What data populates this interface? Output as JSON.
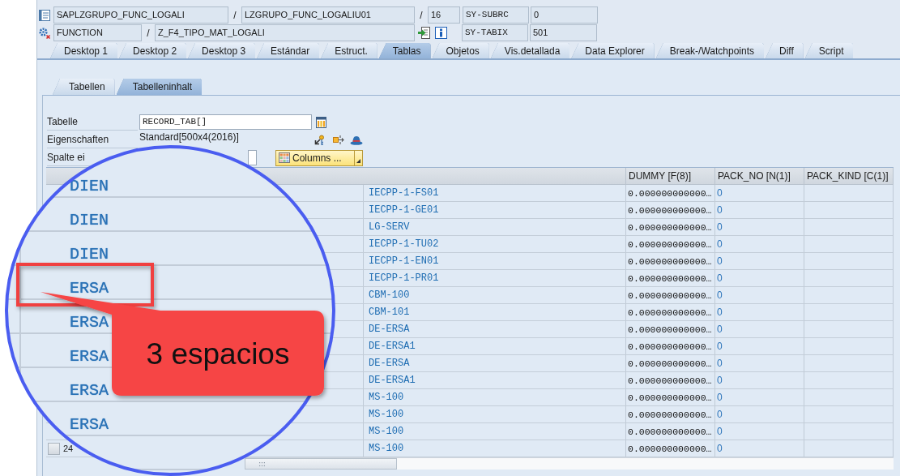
{
  "program_line": {
    "program": "SAPLZGRUPO_FUNC_LOGALI",
    "separator_1": "/",
    "include": "LZGRUPO_FUNC_LOGALIU01",
    "separator_2": "/",
    "line": "16",
    "variable": "SY-SUBRC",
    "value": "0"
  },
  "event_line": {
    "type": "FUNCTION",
    "separator": "/",
    "name": "Z_F4_TIPO_MAT_LOGALI",
    "variable": "SY-TABIX",
    "value": "501"
  },
  "tabs": [
    {
      "label": "Desktop 1",
      "selected": false
    },
    {
      "label": "Desktop 2",
      "selected": false
    },
    {
      "label": "Desktop 3",
      "selected": false
    },
    {
      "label": "Estándar",
      "selected": false
    },
    {
      "label": "Estruct.",
      "selected": false
    },
    {
      "label": "Tablas",
      "selected": true
    },
    {
      "label": "Objetos",
      "selected": false
    },
    {
      "label": "Vis.detallada",
      "selected": false
    },
    {
      "label": "Data Explorer",
      "selected": false
    },
    {
      "label": "Break-/Watchpoints",
      "selected": false
    },
    {
      "label": "Diff",
      "selected": false
    },
    {
      "label": "Script",
      "selected": false
    }
  ],
  "sub_tabs": [
    {
      "label": "Tabellen",
      "selected": false
    },
    {
      "label": "Tabelleninhalt",
      "selected": true
    }
  ],
  "form": {
    "table_label": "Tabelle",
    "table_value": "RECORD_TAB[]",
    "properties_label": "Eigenschaften",
    "properties_value": "Standard[500x4(2016)]",
    "column_label": "Spalte ei",
    "columns_button": "Columns ..."
  },
  "table": {
    "columns": [
      "DUMMY [F(8)]",
      "PACK_NO [N(1)]",
      "PACK_KIND [C(1)]"
    ],
    "rows": [
      {
        "column_2": "IECPP-1-FS01",
        "dummy": "0.000000000000…",
        "pack_no": "0"
      },
      {
        "column_2": "IECPP-1-GE01",
        "dummy": "0.000000000000…",
        "pack_no": "0"
      },
      {
        "column_2": "LG-SERV",
        "dummy": "0.000000000000…",
        "pack_no": "0"
      },
      {
        "column_2": "IECPP-1-TU02",
        "dummy": "0.000000000000…",
        "pack_no": "0"
      },
      {
        "column_2": "IECPP-1-EN01",
        "dummy": "0.000000000000…",
        "pack_no": "0"
      },
      {
        "column_2": "IECPP-1-PR01",
        "dummy": "0.000000000000…",
        "pack_no": "0"
      },
      {
        "column_2": "CBM-100",
        "dummy": "0.000000000000…",
        "pack_no": "0"
      },
      {
        "column_2": "CBM-101",
        "dummy": "0.000000000000…",
        "pack_no": "0"
      },
      {
        "column_2": "DE-ERSA",
        "dummy": "0.000000000000…",
        "pack_no": "0"
      },
      {
        "column_2": "DE-ERSA1",
        "dummy": "0.000000000000…",
        "pack_no": "0"
      },
      {
        "column_2": "DE-ERSA",
        "dummy": "0.000000000000…",
        "pack_no": "0"
      },
      {
        "column_2": "DE-ERSA1",
        "dummy": "0.000000000000…",
        "pack_no": "0"
      },
      {
        "column_2": "MS-100",
        "dummy": "0.000000000000…",
        "pack_no": "0"
      },
      {
        "column_2": "MS-100",
        "dummy": "0.000000000000…",
        "pack_no": "0"
      },
      {
        "column_2": "MS-100",
        "dummy": "0.000000000000…",
        "pack_no": "0"
      },
      {
        "column_1": "24",
        "column_2": "MS-100",
        "dummy": "0.000000000000…",
        "pack_no": "0"
      }
    ]
  },
  "magnifier": {
    "rows": [
      {
        "text": "DIEN",
        "highlighted": false
      },
      {
        "text": "DIEN",
        "highlighted": false
      },
      {
        "text": "DIEN",
        "highlighted": false
      },
      {
        "text": "ERSA",
        "highlighted": true
      },
      {
        "text": "ERSA",
        "highlighted": false
      },
      {
        "text": "ERSA",
        "highlighted": false
      },
      {
        "text": "ERSA",
        "highlighted": false
      },
      {
        "text": "ERSA",
        "highlighted": false
      }
    ]
  },
  "callout": {
    "text": "3 espacios"
  }
}
